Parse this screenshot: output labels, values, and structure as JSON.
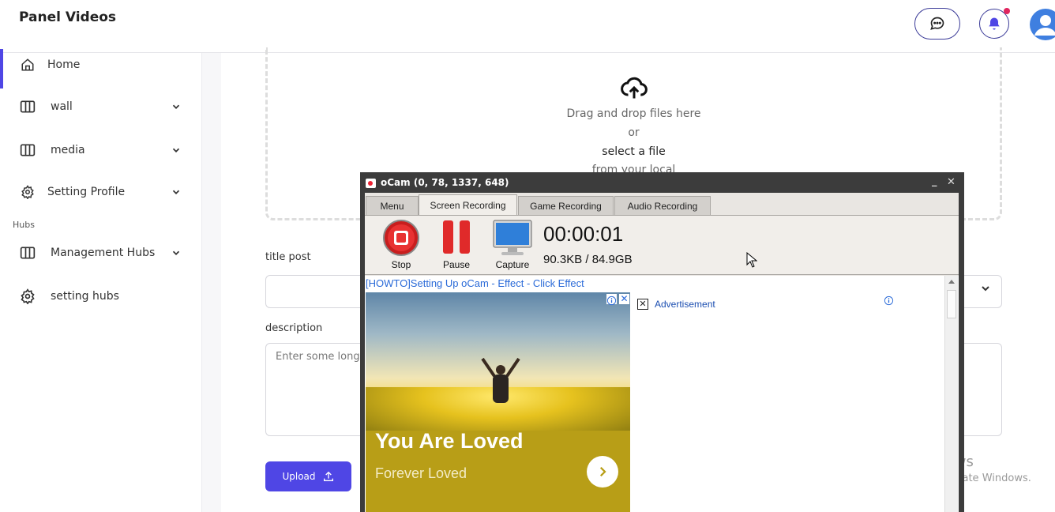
{
  "header": {
    "title": "Panel Videos"
  },
  "sidebar": {
    "items": [
      {
        "label": "Home",
        "icon": "home-icon"
      },
      {
        "label": "wall",
        "icon": "columns-icon"
      },
      {
        "label": "media",
        "icon": "columns-icon"
      },
      {
        "label": "Setting Profile",
        "icon": "gear-icon"
      },
      {
        "label": "Management Hubs",
        "icon": "columns-icon"
      },
      {
        "label": "setting hubs",
        "icon": "gear-icon"
      }
    ],
    "section_label": "Hubs"
  },
  "upload_zone": {
    "line1": "Drag and drop files here",
    "line2": "or",
    "line3": "select a file",
    "line4": "from your local"
  },
  "form": {
    "title_label": "title post",
    "description_label": "description",
    "description_placeholder": "Enter some long",
    "upload_button": "Upload"
  },
  "watermark": {
    "line1": "Activate Windows",
    "line2": "Go to Settings to activate Windows."
  },
  "ocam": {
    "title": "oCam (0, 78, 1337, 648)",
    "tabs": [
      "Menu",
      "Screen Recording",
      "Game Recording",
      "Audio Recording"
    ],
    "active_tab": "Screen Recording",
    "tools": [
      "Stop",
      "Pause",
      "Capture"
    ],
    "timer": "00:00:01",
    "size": "90.3KB / 84.9GB",
    "howto_link": "[HOWTO]Setting Up oCam - Effect - Click Effect",
    "ad_headline": "You Are Loved",
    "ad_subline": "Forever Loved",
    "ad_label": "Advertisement"
  },
  "colors": {
    "accent": "#4f46e5",
    "ocam_frame": "#3c3c3c",
    "notification": "#e0245e"
  }
}
